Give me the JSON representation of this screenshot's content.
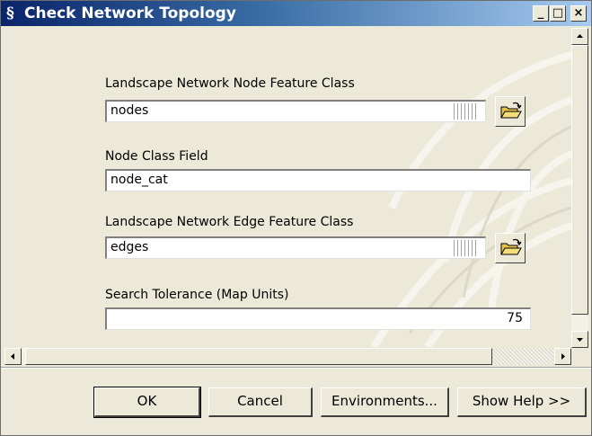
{
  "window": {
    "title": "Check Network Topology",
    "title_icon": "script-icon",
    "minimize_glyph": "_",
    "maximize_glyph": "□",
    "close_glyph": "×"
  },
  "params": {
    "node_fc_label": "Landscape Network Node Feature Class",
    "node_fc_value": "nodes",
    "node_field_label": "Node Class Field",
    "node_field_value": "node_cat",
    "edge_fc_label": "Landscape Network Edge Feature Class",
    "edge_fc_value": "edges",
    "tolerance_label": "Search Tolerance (Map Units)",
    "tolerance_value": "75"
  },
  "buttons": {
    "ok": "OK",
    "cancel": "Cancel",
    "environments": "Environments...",
    "show_help": "Show Help >>"
  },
  "colors": {
    "titlebar_start": "#0a246a",
    "titlebar_end": "#a6caf0",
    "dialog_face": "#ece9d8",
    "folder_yellow": "#e8c34a"
  },
  "icons": [
    "script-icon",
    "minimize-icon",
    "maximize-icon",
    "close-icon",
    "folder-open-icon",
    "scroll-up-icon",
    "scroll-down-icon",
    "scroll-left-icon",
    "scroll-right-icon"
  ]
}
